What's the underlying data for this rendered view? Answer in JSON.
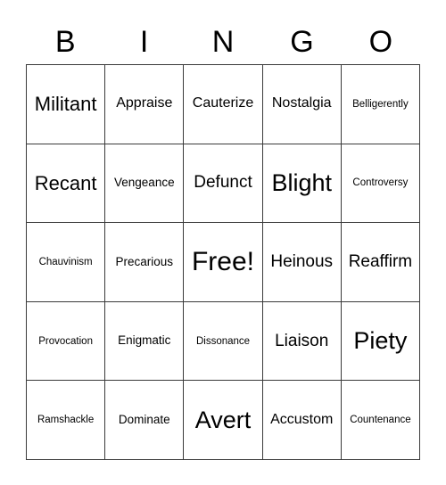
{
  "card": {
    "header_letters": [
      "B",
      "I",
      "N",
      "G",
      "O"
    ],
    "columns": 5,
    "rows": 5,
    "border_color": "#3a3a3a",
    "background_color": "#ffffff",
    "text_color": "#000000",
    "free_space": {
      "label": "Free!",
      "row": 3,
      "column": 3
    },
    "grid": [
      [
        {
          "text": "Militant",
          "size": "xl"
        },
        {
          "text": "Appraise",
          "size": "m"
        },
        {
          "text": "Cauterize",
          "size": "m"
        },
        {
          "text": "Nostalgia",
          "size": "m"
        },
        {
          "text": "Belligerently",
          "size": "xs"
        }
      ],
      [
        {
          "text": "Recant",
          "size": "xl"
        },
        {
          "text": "Vengeance",
          "size": "s"
        },
        {
          "text": "Defunct",
          "size": "l"
        },
        {
          "text": "Blight",
          "size": "xxl"
        },
        {
          "text": "Controversy",
          "size": "xs"
        }
      ],
      [
        {
          "text": "Chauvinism",
          "size": "xs"
        },
        {
          "text": "Precarious",
          "size": "s"
        },
        {
          "text": "Free!",
          "size": "free"
        },
        {
          "text": "Heinous",
          "size": "l"
        },
        {
          "text": "Reaffirm",
          "size": "l"
        }
      ],
      [
        {
          "text": "Provocation",
          "size": "xs"
        },
        {
          "text": "Enigmatic",
          "size": "s"
        },
        {
          "text": "Dissonance",
          "size": "xs"
        },
        {
          "text": "Liaison",
          "size": "l"
        },
        {
          "text": "Piety",
          "size": "xxl"
        }
      ],
      [
        {
          "text": "Ramshackle",
          "size": "xs"
        },
        {
          "text": "Dominate",
          "size": "s"
        },
        {
          "text": "Avert",
          "size": "xxl"
        },
        {
          "text": "Accustom",
          "size": "m"
        },
        {
          "text": "Countenance",
          "size": "xs"
        }
      ]
    ]
  }
}
